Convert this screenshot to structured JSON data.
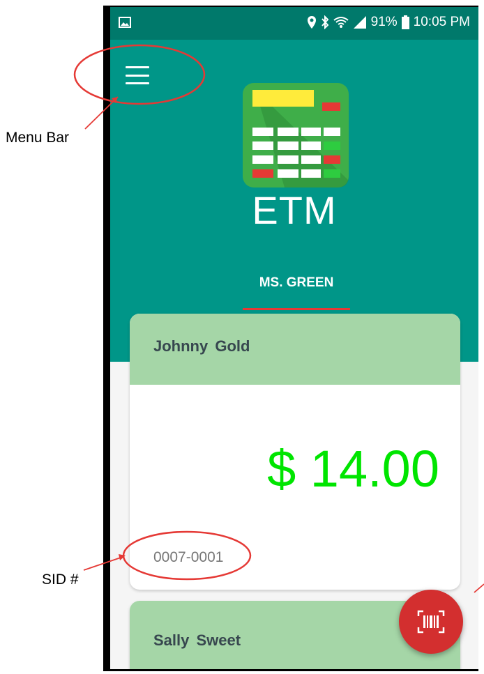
{
  "annotations": {
    "menu_bar_label": "Menu Bar",
    "sid_label": "SID #"
  },
  "status_bar": {
    "battery": "91%",
    "time": "10:05 PM"
  },
  "app": {
    "title": "ETM"
  },
  "tabs": [
    {
      "label": "MS. GREEN"
    }
  ],
  "students": [
    {
      "name": "Johnny  Gold",
      "balance": "$ 14.00",
      "sid": "0007-0001"
    },
    {
      "name": "Sally  Sweet"
    }
  ],
  "icons": {
    "menu": "menu-icon",
    "scan": "barcode-scan-icon"
  },
  "colors": {
    "primary": "#009688",
    "status_bar": "#00796b",
    "card_header": "#a5d6a7",
    "amount": "#00e500",
    "accent": "#d32f2f"
  }
}
